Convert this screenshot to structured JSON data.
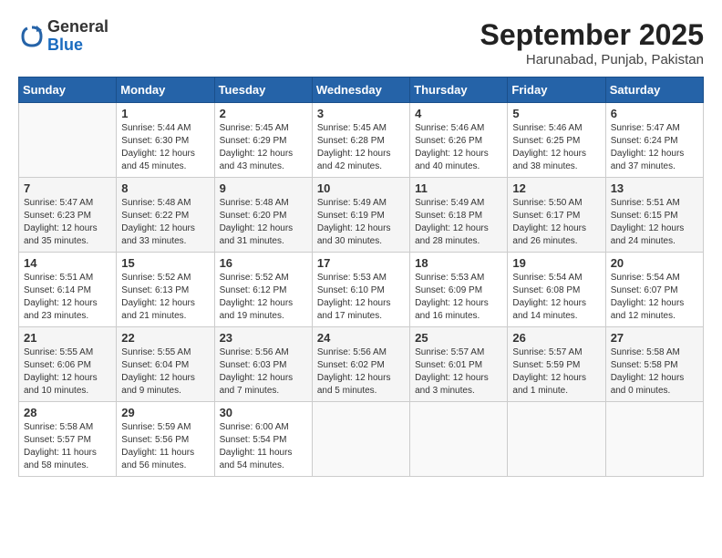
{
  "header": {
    "logo": {
      "line1": "General",
      "line2": "Blue"
    },
    "title": "September 2025",
    "subtitle": "Harunabad, Punjab, Pakistan"
  },
  "weekdays": [
    "Sunday",
    "Monday",
    "Tuesday",
    "Wednesday",
    "Thursday",
    "Friday",
    "Saturday"
  ],
  "weeks": [
    [
      {
        "day": "",
        "info": ""
      },
      {
        "day": "1",
        "info": "Sunrise: 5:44 AM\nSunset: 6:30 PM\nDaylight: 12 hours\nand 45 minutes."
      },
      {
        "day": "2",
        "info": "Sunrise: 5:45 AM\nSunset: 6:29 PM\nDaylight: 12 hours\nand 43 minutes."
      },
      {
        "day": "3",
        "info": "Sunrise: 5:45 AM\nSunset: 6:28 PM\nDaylight: 12 hours\nand 42 minutes."
      },
      {
        "day": "4",
        "info": "Sunrise: 5:46 AM\nSunset: 6:26 PM\nDaylight: 12 hours\nand 40 minutes."
      },
      {
        "day": "5",
        "info": "Sunrise: 5:46 AM\nSunset: 6:25 PM\nDaylight: 12 hours\nand 38 minutes."
      },
      {
        "day": "6",
        "info": "Sunrise: 5:47 AM\nSunset: 6:24 PM\nDaylight: 12 hours\nand 37 minutes."
      }
    ],
    [
      {
        "day": "7",
        "info": "Sunrise: 5:47 AM\nSunset: 6:23 PM\nDaylight: 12 hours\nand 35 minutes."
      },
      {
        "day": "8",
        "info": "Sunrise: 5:48 AM\nSunset: 6:22 PM\nDaylight: 12 hours\nand 33 minutes."
      },
      {
        "day": "9",
        "info": "Sunrise: 5:48 AM\nSunset: 6:20 PM\nDaylight: 12 hours\nand 31 minutes."
      },
      {
        "day": "10",
        "info": "Sunrise: 5:49 AM\nSunset: 6:19 PM\nDaylight: 12 hours\nand 30 minutes."
      },
      {
        "day": "11",
        "info": "Sunrise: 5:49 AM\nSunset: 6:18 PM\nDaylight: 12 hours\nand 28 minutes."
      },
      {
        "day": "12",
        "info": "Sunrise: 5:50 AM\nSunset: 6:17 PM\nDaylight: 12 hours\nand 26 minutes."
      },
      {
        "day": "13",
        "info": "Sunrise: 5:51 AM\nSunset: 6:15 PM\nDaylight: 12 hours\nand 24 minutes."
      }
    ],
    [
      {
        "day": "14",
        "info": "Sunrise: 5:51 AM\nSunset: 6:14 PM\nDaylight: 12 hours\nand 23 minutes."
      },
      {
        "day": "15",
        "info": "Sunrise: 5:52 AM\nSunset: 6:13 PM\nDaylight: 12 hours\nand 21 minutes."
      },
      {
        "day": "16",
        "info": "Sunrise: 5:52 AM\nSunset: 6:12 PM\nDaylight: 12 hours\nand 19 minutes."
      },
      {
        "day": "17",
        "info": "Sunrise: 5:53 AM\nSunset: 6:10 PM\nDaylight: 12 hours\nand 17 minutes."
      },
      {
        "day": "18",
        "info": "Sunrise: 5:53 AM\nSunset: 6:09 PM\nDaylight: 12 hours\nand 16 minutes."
      },
      {
        "day": "19",
        "info": "Sunrise: 5:54 AM\nSunset: 6:08 PM\nDaylight: 12 hours\nand 14 minutes."
      },
      {
        "day": "20",
        "info": "Sunrise: 5:54 AM\nSunset: 6:07 PM\nDaylight: 12 hours\nand 12 minutes."
      }
    ],
    [
      {
        "day": "21",
        "info": "Sunrise: 5:55 AM\nSunset: 6:06 PM\nDaylight: 12 hours\nand 10 minutes."
      },
      {
        "day": "22",
        "info": "Sunrise: 5:55 AM\nSunset: 6:04 PM\nDaylight: 12 hours\nand 9 minutes."
      },
      {
        "day": "23",
        "info": "Sunrise: 5:56 AM\nSunset: 6:03 PM\nDaylight: 12 hours\nand 7 minutes."
      },
      {
        "day": "24",
        "info": "Sunrise: 5:56 AM\nSunset: 6:02 PM\nDaylight: 12 hours\nand 5 minutes."
      },
      {
        "day": "25",
        "info": "Sunrise: 5:57 AM\nSunset: 6:01 PM\nDaylight: 12 hours\nand 3 minutes."
      },
      {
        "day": "26",
        "info": "Sunrise: 5:57 AM\nSunset: 5:59 PM\nDaylight: 12 hours\nand 1 minute."
      },
      {
        "day": "27",
        "info": "Sunrise: 5:58 AM\nSunset: 5:58 PM\nDaylight: 12 hours\nand 0 minutes."
      }
    ],
    [
      {
        "day": "28",
        "info": "Sunrise: 5:58 AM\nSunset: 5:57 PM\nDaylight: 11 hours\nand 58 minutes."
      },
      {
        "day": "29",
        "info": "Sunrise: 5:59 AM\nSunset: 5:56 PM\nDaylight: 11 hours\nand 56 minutes."
      },
      {
        "day": "30",
        "info": "Sunrise: 6:00 AM\nSunset: 5:54 PM\nDaylight: 11 hours\nand 54 minutes."
      },
      {
        "day": "",
        "info": ""
      },
      {
        "day": "",
        "info": ""
      },
      {
        "day": "",
        "info": ""
      },
      {
        "day": "",
        "info": ""
      }
    ]
  ]
}
